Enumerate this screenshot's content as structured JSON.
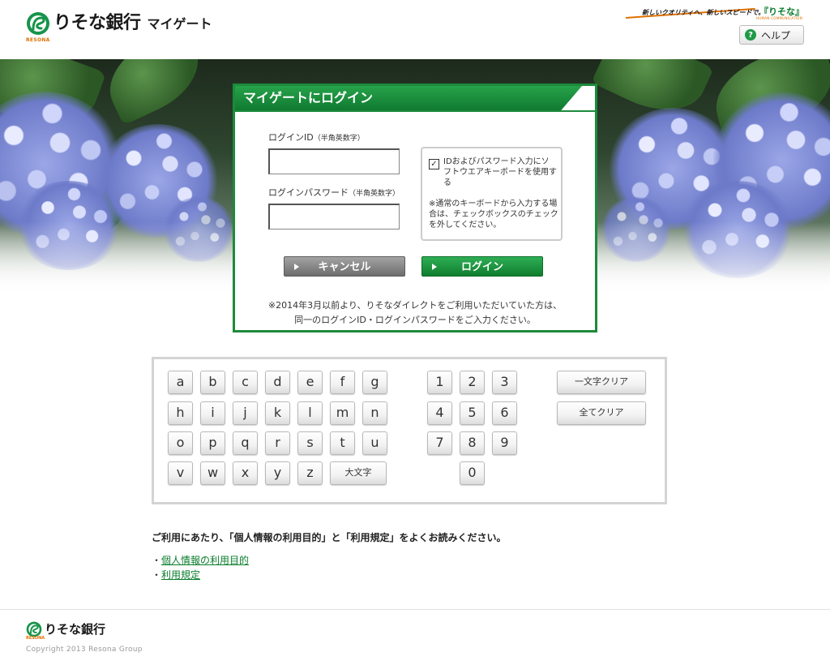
{
  "header": {
    "brand": "りそな銀行",
    "product": "マイゲート",
    "logo_sub": "RESONA",
    "tagline": "新しいクオリティへ、新しいスピードで。",
    "tagline_brand": "『りそな』",
    "tagline_sub": "HUMAN COMMUNICATION",
    "help_label": "ヘルプ",
    "help_icon": "?"
  },
  "login": {
    "title": "マイゲートにログイン",
    "id_label": "ログインID",
    "id_hint": "（半角英数字）",
    "id_value": "",
    "pw_label": "ログインパスワード",
    "pw_hint": "（半角英数字）",
    "pw_value": "",
    "software_kb_checkbox": "IDおよびパスワード入力にソフトウエアキーボードを使用する",
    "software_kb_checked": true,
    "check_mark": "✓",
    "software_kb_note": "※通常のキーボードから入力する場合は、チェックボックスのチェックを外してください。",
    "cancel_label": "キャンセル",
    "login_label": "ログイン",
    "note_line1": "※2014年3月以前より、りそなダイレクトをご利用いただいていた方は、",
    "note_line2": "同一のログインID・ログインパスワードをご入力ください。"
  },
  "keyboard": {
    "row1": [
      "a",
      "b",
      "c",
      "d",
      "e",
      "f",
      "g"
    ],
    "row2": [
      "h",
      "i",
      "j",
      "k",
      "l",
      "m",
      "n"
    ],
    "row3": [
      "o",
      "p",
      "q",
      "r",
      "s",
      "t",
      "u"
    ],
    "row4": [
      "v",
      "w",
      "x",
      "y",
      "z"
    ],
    "uppercase_label": "大文字",
    "digits_row1": [
      "1",
      "2",
      "3"
    ],
    "digits_row2": [
      "4",
      "5",
      "6"
    ],
    "digits_row3": [
      "7",
      "8",
      "9"
    ],
    "digit_zero": "0",
    "clear_one_label": "一文字クリア",
    "clear_all_label": "全てクリア"
  },
  "terms": {
    "title": "ご利用にあたり、「個人情報の利用目的」と「利用規定」をよくお読みください。",
    "bullet": "・",
    "links": [
      {
        "label": "個人情報の利用目的"
      },
      {
        "label": "利用規定"
      }
    ]
  },
  "footer": {
    "brand": "りそな銀行",
    "logo_sub": "RESONA",
    "copyright": "Copyright 2013 Resona Group"
  },
  "colors": {
    "brand_green": "#1c8b3b",
    "link_green": "#0a7d2c",
    "accent_orange": "#e07000"
  }
}
